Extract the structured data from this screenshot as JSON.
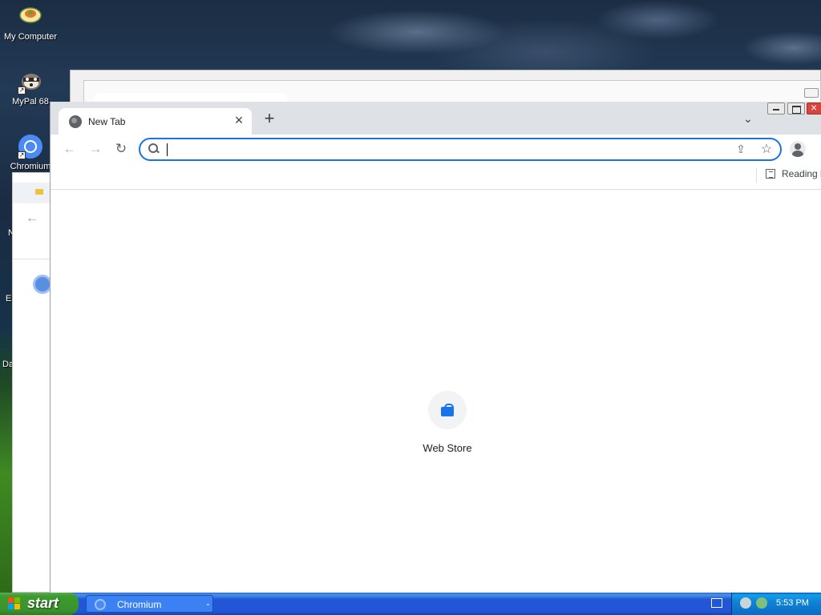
{
  "desktop": {
    "icons": [
      {
        "label": "My Computer"
      },
      {
        "label": "MyPal 68"
      },
      {
        "label": "Chromium"
      }
    ],
    "partial_labels": [
      "N",
      "Er",
      "Da"
    ]
  },
  "browser": {
    "tab": {
      "title": "New Tab",
      "close_glyph": "×"
    },
    "new_tab_glyph": "+",
    "tab_search_glyph": "⌄",
    "nav": {
      "back_glyph": "←",
      "forward_glyph": "→",
      "reload_glyph": "↻"
    },
    "omnibox": {
      "value": "",
      "placeholder": ""
    },
    "share_glyph": "⇪",
    "star_glyph": "☆",
    "bookmarks_bar": {
      "reading_list_label": "Reading li"
    },
    "shortcuts": [
      {
        "label": "Web Store"
      }
    ]
  },
  "taskbar": {
    "start_label": "start",
    "tasks": [
      {
        "label": "Chromium",
        "arrow": "⌄"
      }
    ],
    "clock": "5:53 PM"
  },
  "colors": {
    "accent": "#1a73e8",
    "tabstrip": "#dee1e6",
    "taskbar": "#2157d7",
    "start_green": "#3c9c2d",
    "close_red": "#d9453a"
  },
  "icons": [
    "my-computer-icon",
    "mypal-icon",
    "chromium-icon",
    "globe-icon",
    "search-icon",
    "share-icon",
    "star-icon",
    "profile-icon",
    "reading-list-icon",
    "web-store-icon",
    "windows-flag-icon",
    "keyboard-icon",
    "network-icon",
    "speaker-icon"
  ]
}
